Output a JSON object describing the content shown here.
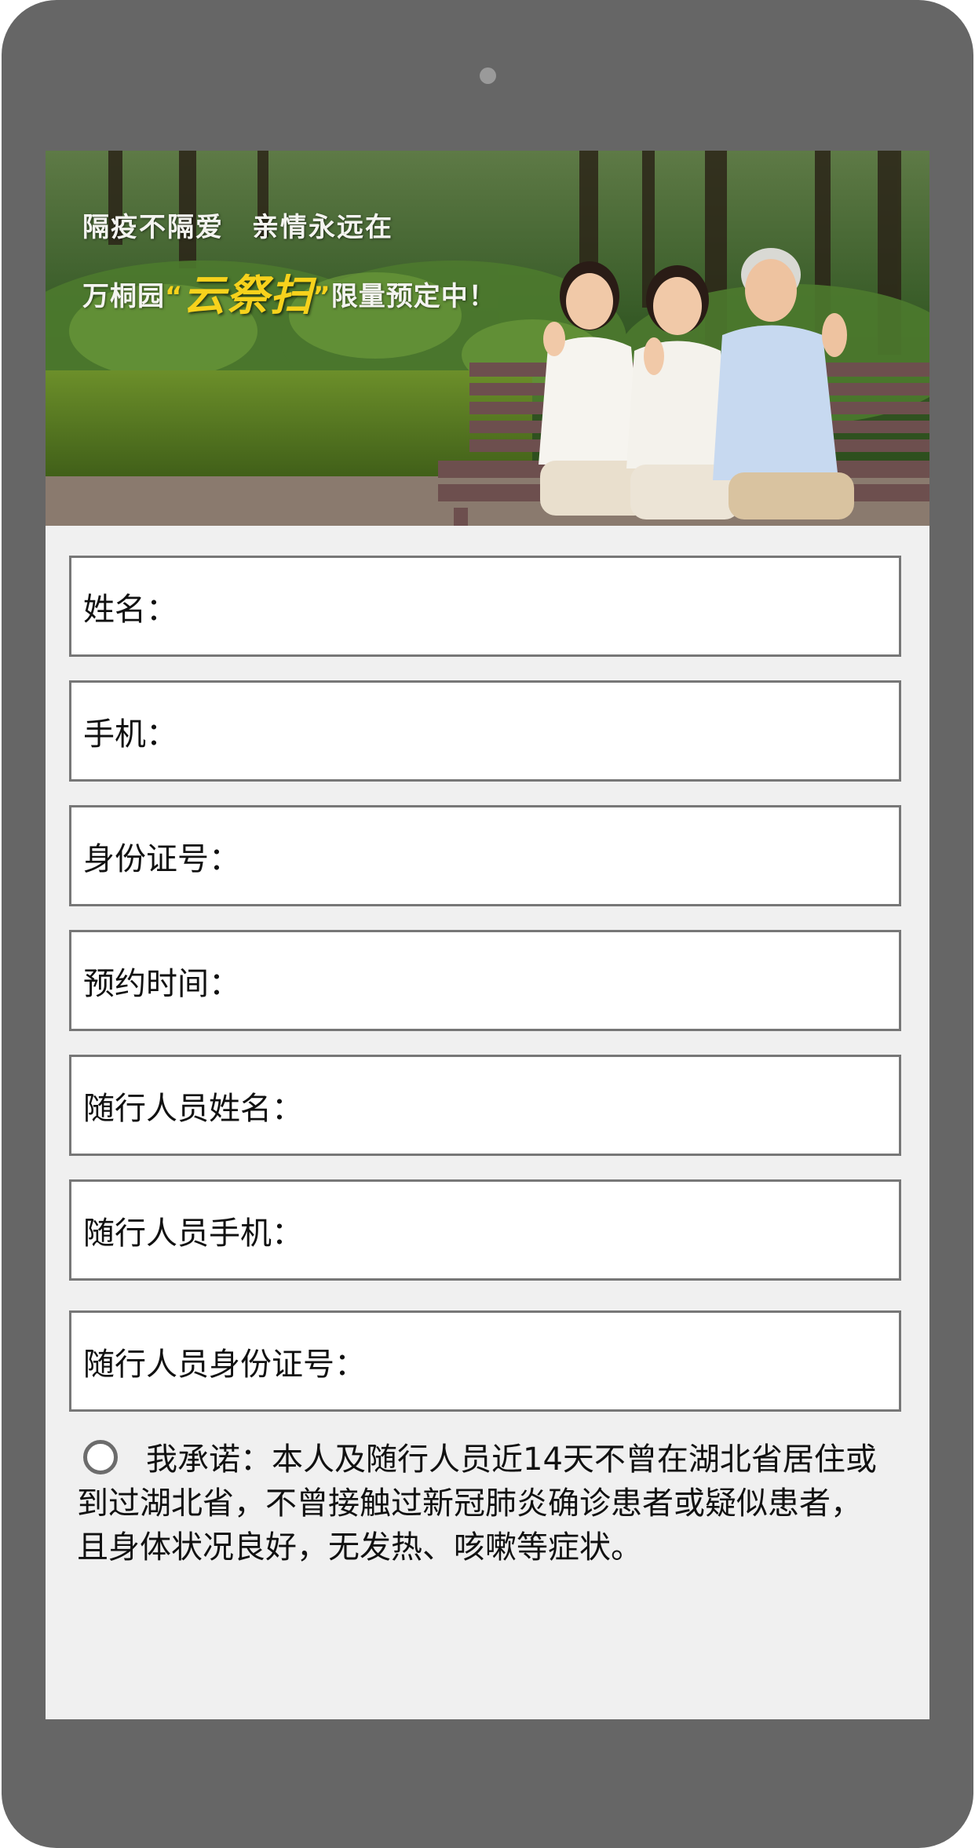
{
  "banner": {
    "line1_a": "隔疫不隔爱",
    "line1_b": "亲情永远在",
    "line2_pre": "万桐园",
    "line2_open_quote": "“",
    "line2_highlight": "云祭扫",
    "line2_close_quote": "”",
    "line2_post": "限量预定中！"
  },
  "form": {
    "fields": [
      {
        "label": "姓名："
      },
      {
        "label": "手机："
      },
      {
        "label": "身份证号："
      },
      {
        "label": "预约时间："
      },
      {
        "label": "随行人员姓名："
      },
      {
        "label": "随行人员手机："
      },
      {
        "label": "随行人员身份证号："
      }
    ],
    "agreement": "我承诺：本人及随行人员近14天不曾在湖北省居住或到过湖北省，不曾接触过新冠肺炎确诊患者或疑似患者，且身体状况良好，无发热、咳嗽等症状。",
    "agreement_checked": false
  },
  "colors": {
    "device_frame": "#666666",
    "screen_bg": "#f0f0f0",
    "field_border": "#777777",
    "banner_highlight": "#f7d21c"
  }
}
